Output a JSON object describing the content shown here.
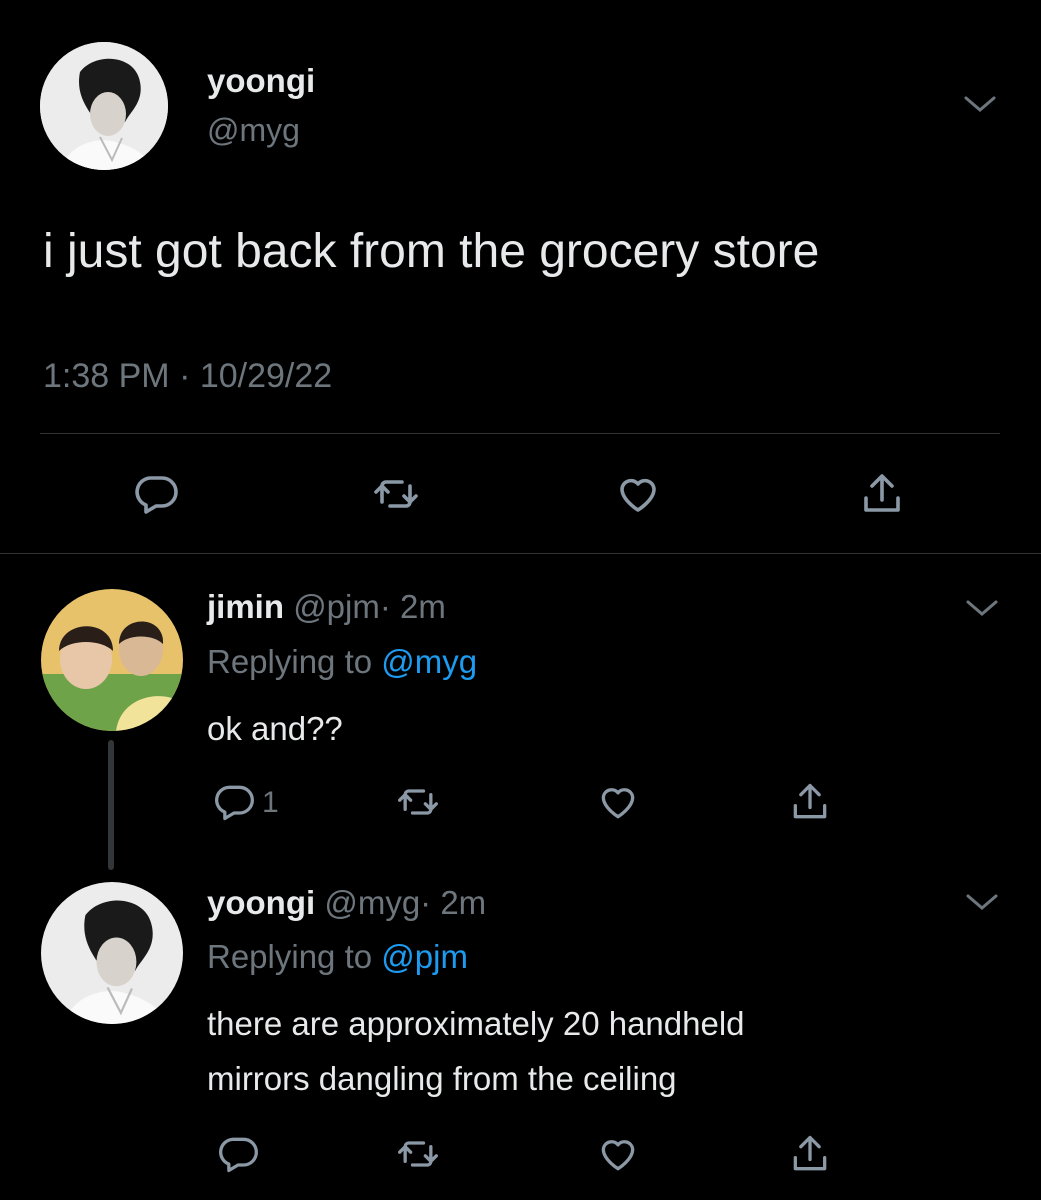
{
  "main_tweet": {
    "display_name": "yoongi",
    "handle": "@myg",
    "text": "i just got back from the grocery store",
    "timestamp": "1:38 PM · 10/29/22"
  },
  "replies": [
    {
      "display_name": "jimin",
      "handle": "@pjm",
      "time": "· 2m",
      "replying_prefix": "Replying to",
      "replying_to": "@myg",
      "text": "ok and??",
      "reply_count": "1"
    },
    {
      "display_name": "yoongi",
      "handle": "@myg",
      "time": "· 2m",
      "replying_prefix": "Replying to",
      "replying_to": "@pjm",
      "text_line1": "there are approximately 20 handheld",
      "text_line2": "mirrors dangling from the ceiling"
    }
  ],
  "icons": [
    "reply-icon",
    "retweet-icon",
    "like-icon",
    "share-icon",
    "chevron-down-icon"
  ],
  "colors": {
    "background": "#000000",
    "text": "#e7e9ea",
    "muted": "#6e767d",
    "link": "#1d9bf0",
    "divider": "#2f3336"
  }
}
